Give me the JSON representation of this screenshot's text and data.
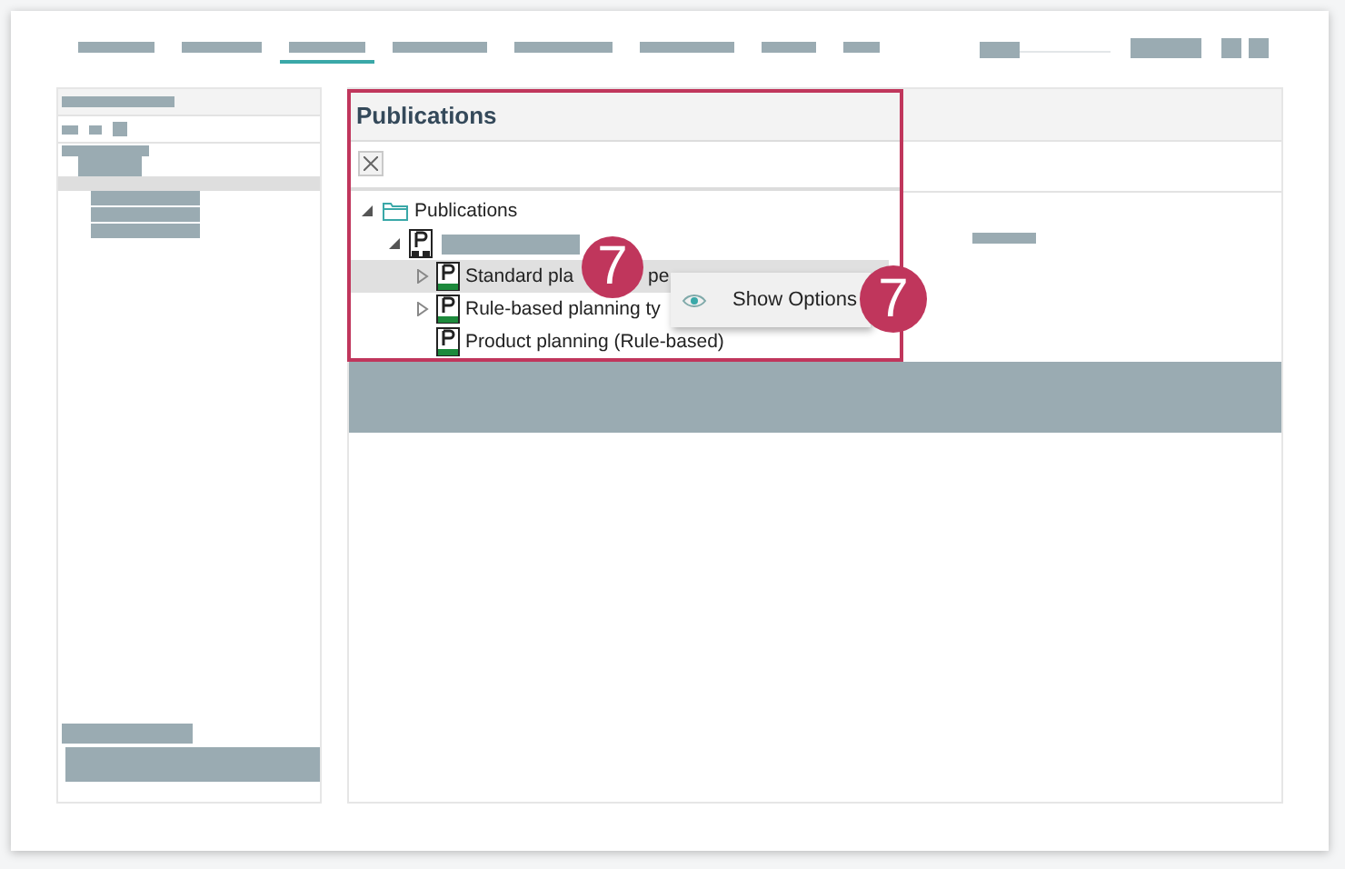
{
  "nav": {
    "tabs": [
      {
        "selected": false
      },
      {
        "selected": false
      },
      {
        "selected": true
      },
      {
        "selected": false
      },
      {
        "selected": false
      },
      {
        "selected": false
      },
      {
        "selected": false
      },
      {
        "selected": false
      }
    ]
  },
  "panel": {
    "title": "Publications"
  },
  "tree": [
    {
      "label": "Publications",
      "kind": "folder",
      "expanded": true,
      "selected": false,
      "children": [
        {
          "kind": "publication",
          "expanded": true,
          "selected": false,
          "children": [
            {
              "label": "Standard pla",
              "tail": "pe",
              "kind": "planning",
              "expanded": false,
              "selected": true
            },
            {
              "label": "Rule-based planning ty",
              "kind": "planning",
              "expanded": false,
              "selected": false
            },
            {
              "label": "Product planning (Rule-based)",
              "kind": "planning",
              "selected": false
            }
          ]
        }
      ]
    }
  ],
  "context_menu": {
    "items": [
      {
        "label": "Show Options"
      }
    ]
  },
  "callouts": [
    {
      "number": "7"
    },
    {
      "number": "7"
    }
  ]
}
